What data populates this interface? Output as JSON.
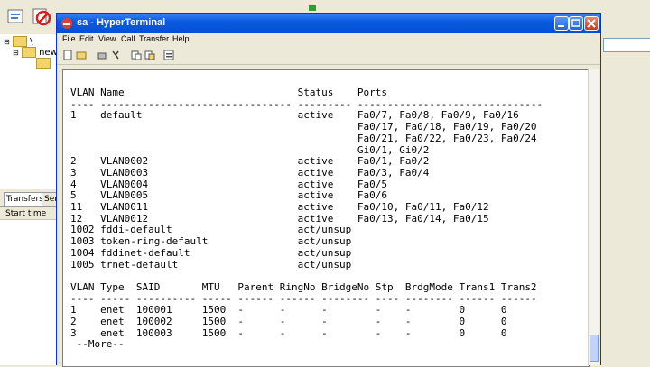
{
  "window": {
    "title": "sa - HyperTerminal",
    "menu": [
      "File",
      "Edit",
      "View",
      "Call",
      "Transfer",
      "Help"
    ]
  },
  "background": {
    "tree": [
      "\\",
      "new"
    ],
    "tabs": [
      "Transfers",
      "Serv"
    ],
    "list_header": "Start time"
  },
  "terminal": {
    "lines": [
      "VLAN Name                             Status    Ports",
      "---- -------------------------------- --------- -------------------------------",
      "1    default                          active    Fa0/7, Fa0/8, Fa0/9, Fa0/16",
      "                                                Fa0/17, Fa0/18, Fa0/19, Fa0/20",
      "                                                Fa0/21, Fa0/22, Fa0/23, Fa0/24",
      "                                                Gi0/1, Gi0/2",
      "2    VLAN0002                         active    Fa0/1, Fa0/2",
      "3    VLAN0003                         active    Fa0/3, Fa0/4",
      "4    VLAN0004                         active    Fa0/5",
      "5    VLAN0005                         active    Fa0/6",
      "11   VLAN0011                         active    Fa0/10, Fa0/11, Fa0/12",
      "12   VLAN0012                         active    Fa0/13, Fa0/14, Fa0/15",
      "1002 fddi-default                     act/unsup",
      "1003 token-ring-default               act/unsup",
      "1004 fddinet-default                  act/unsup",
      "1005 trnet-default                    act/unsup",
      "",
      "VLAN Type  SAID       MTU   Parent RingNo BridgeNo Stp  BrdgMode Trans1 Trans2",
      "---- ----- ---------- ----- ------ ------ -------- ---- -------- ------ ------",
      "1    enet  100001     1500  -      -      -        -    -        0      0",
      "2    enet  100002     1500  -      -      -        -    -        0      0",
      "3    enet  100003     1500  -      -      -        -    -        0      0",
      " --More-- "
    ]
  },
  "colors": {
    "titlebar": "#0a5ae0",
    "terminal_bg": "#ffffff",
    "terminal_fg": "#000000"
  }
}
